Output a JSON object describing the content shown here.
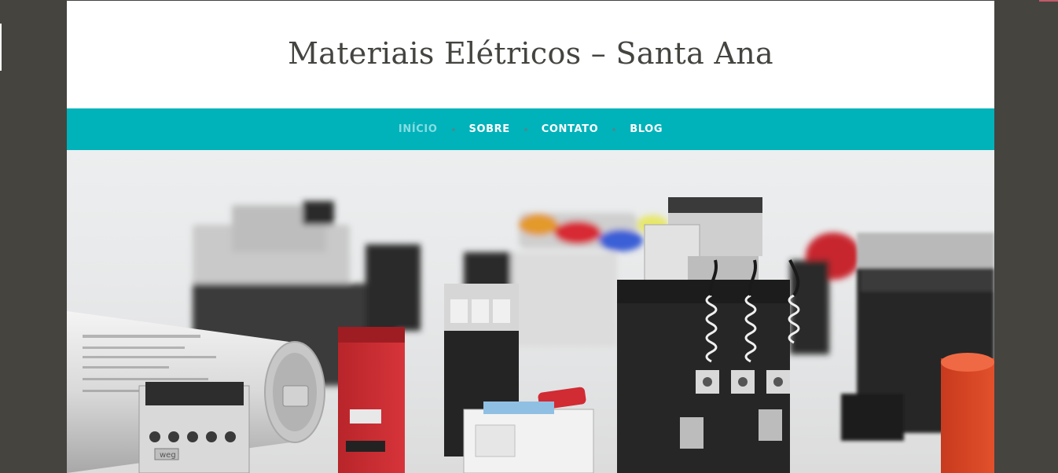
{
  "site": {
    "title": "Materiais Elétricos – Santa Ana"
  },
  "nav": {
    "items": [
      {
        "label": "INÍCIO",
        "active": true
      },
      {
        "label": "SOBRE",
        "active": false
      },
      {
        "label": "CONTATO",
        "active": false
      },
      {
        "label": "BLOG",
        "active": false
      }
    ]
  },
  "hero": {
    "image_subject": "electrical-components-photo",
    "logo_text": "weg"
  },
  "colors": {
    "background": "#46443f",
    "nav_bar": "#00b2ba",
    "nav_active": "#86dde2",
    "title_text": "#444440"
  }
}
